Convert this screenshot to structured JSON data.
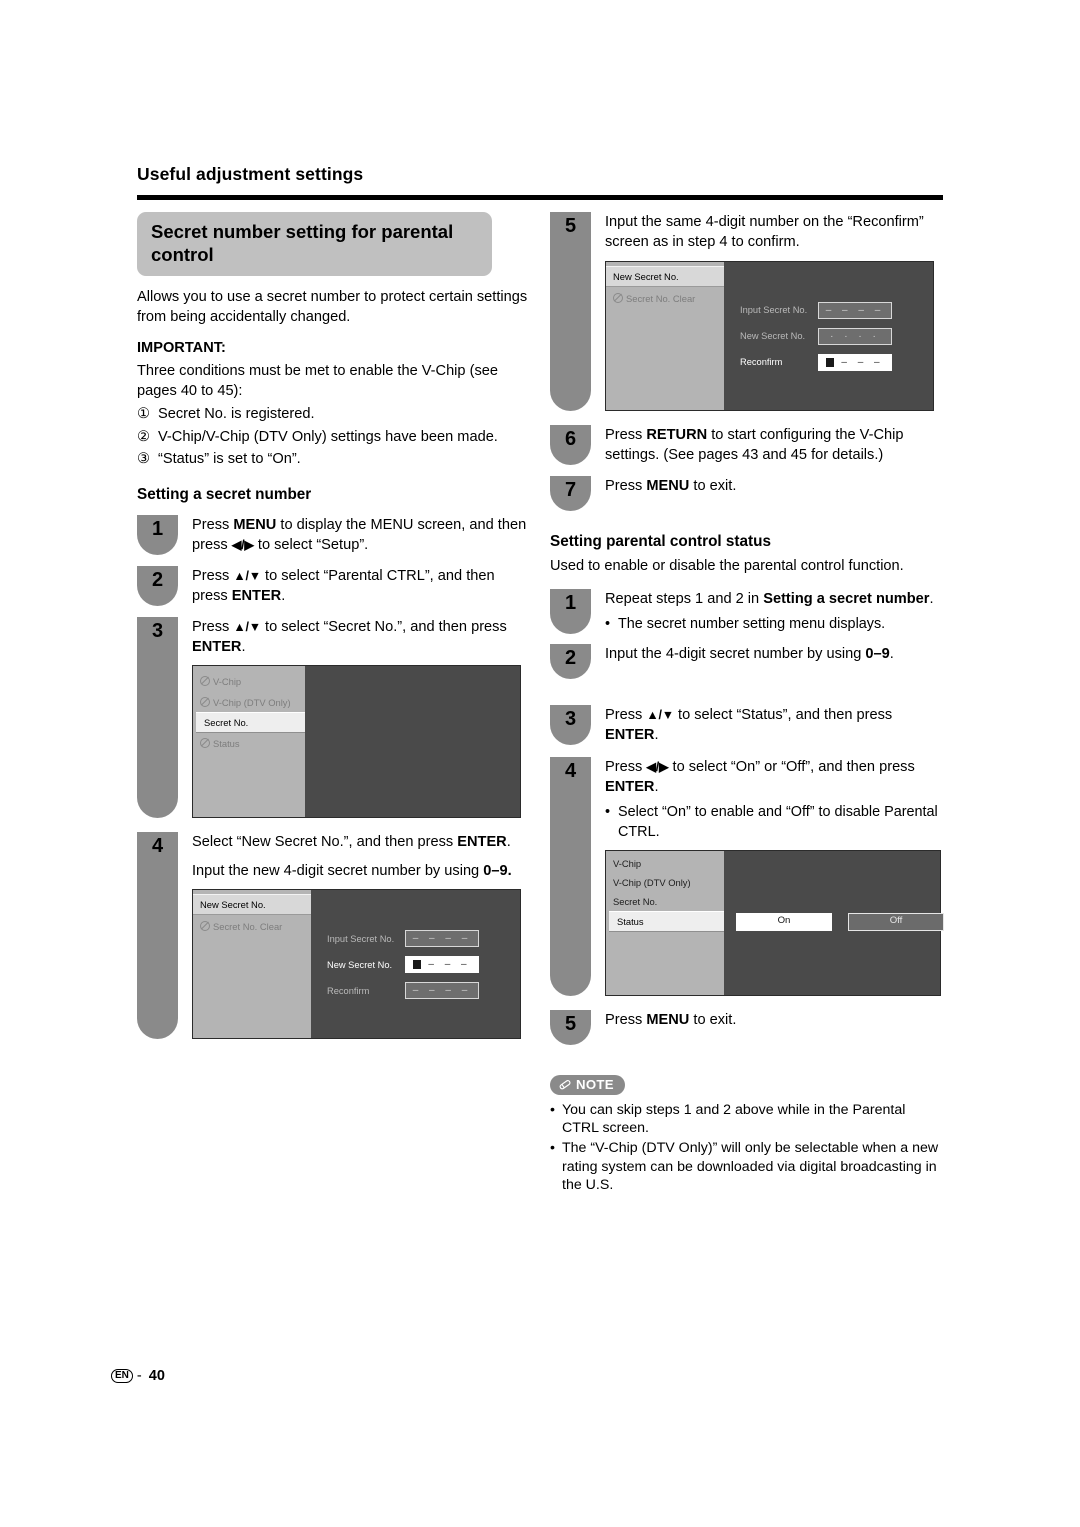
{
  "page": {
    "running_head": "Useful adjustment settings",
    "footer_lang": "EN",
    "footer_dash": "-",
    "footer_page": "40"
  },
  "left": {
    "section_title": "Secret number setting for parental control",
    "intro": "Allows you to use a secret number to protect certain settings from being accidentally changed.",
    "important_label": "IMPORTANT:",
    "important_text": "Three conditions must be met to enable the V-Chip (see pages 40 to 45):",
    "conditions": [
      {
        "num": "①",
        "text": "Secret No. is registered."
      },
      {
        "num": "②",
        "text": "V-Chip/V-Chip (DTV Only) settings have been made."
      },
      {
        "num": "③",
        "text": "“Status” is set to “On”."
      }
    ],
    "subhead": "Setting a secret number",
    "steps": [
      {
        "num": "1",
        "line1_a": "Press ",
        "line1_b": "MENU",
        "line1_c": " to display the MENU screen, and then press ",
        "line1_d": "◀/▶",
        "line1_e": " to select “Setup”."
      },
      {
        "num": "2",
        "line1_a": "Press ",
        "line1_b": "▲/▼",
        "line1_c": " to select “Parental CTRL”, and then press ",
        "line1_d": "ENTER",
        "line1_e": "."
      },
      {
        "num": "3",
        "line1_a": "Press ",
        "line1_b": "▲/▼",
        "line1_c": " to select “Secret No.”, and then press  ",
        "line1_d": "ENTER",
        "line1_e": "."
      },
      {
        "num": "4",
        "line1_a": "Select “New Secret No.”, and then press ",
        "line1_b": "ENTER",
        "line1_c": ".",
        "line2_a": "Input the new 4-digit secret number by using ",
        "line2_b": "0–9."
      }
    ],
    "screen_vchip": {
      "items": [
        {
          "label": "V-Chip",
          "state": "disabled"
        },
        {
          "label": "V-Chip (DTV Only)",
          "state": "disabled"
        },
        {
          "label": "Secret No.",
          "state": "selected"
        },
        {
          "label": "Status",
          "state": "disabled"
        }
      ]
    },
    "screen_newsecret": {
      "items": [
        {
          "label": "New Secret No.",
          "state": "selected-plain"
        },
        {
          "label": "Secret No. Clear",
          "state": "disabled"
        }
      ],
      "fields": [
        {
          "label": "Input Secret No.",
          "value": "– – – –",
          "active": false
        },
        {
          "label": "New Secret No.",
          "value": "– – –",
          "active": true,
          "cursor": true
        },
        {
          "label": "Reconfirm",
          "value": "– – – –",
          "active": false
        }
      ]
    }
  },
  "right": {
    "steps_top": [
      {
        "num": "5",
        "line1_a": "Input the same 4-digit number on the “Reconfirm” screen as in step 4 to confirm.",
        "line1_b": "",
        "line1_c": ""
      },
      {
        "num": "6",
        "line1_a": "Press ",
        "line1_b": "RETURN",
        "line1_c": " to start configuring the V-Chip settings. (See pages 43 and 45 for details.)"
      },
      {
        "num": "7",
        "line1_a": "Press ",
        "line1_b": "MENU",
        "line1_c": " to exit."
      }
    ],
    "screen_reconfirm": {
      "items": [
        {
          "label": "New Secret No.",
          "state": "selected-plain"
        },
        {
          "label": "Secret No. Clear",
          "state": "disabled"
        }
      ],
      "fields": [
        {
          "label": "Input Secret No.",
          "value": "– – – –",
          "active": false
        },
        {
          "label": "New Secret No.",
          "value": "· · · ·",
          "active": false
        },
        {
          "label": "Reconfirm",
          "value": "– – –",
          "active": true,
          "cursor": true
        }
      ]
    },
    "subhead": "Setting parental control status",
    "subhead_text": "Used to enable or disable the parental control function.",
    "steps_bottom": [
      {
        "num": "1",
        "line1_a": "Repeat steps 1 and 2 in ",
        "line1_b": "Setting a secret number",
        "line1_c": ".",
        "bullet": "The secret number setting menu displays."
      },
      {
        "num": "2",
        "line1_a": "Input the 4-digit secret number by using ",
        "line1_b": "0–9",
        "line1_c": "."
      },
      {
        "num": "3",
        "line1_a": "Press ",
        "line1_b": "▲/▼",
        "line1_c": " to select “Status”, and then press ",
        "line1_d": "ENTER",
        "line1_e": "."
      },
      {
        "num": "4",
        "line1_a": "Press ",
        "line1_b": "◀/▶",
        "line1_c": " to select “On” or “Off”, and then press ",
        "line1_d": "ENTER",
        "line1_e": ".",
        "bullet": "Select “On” to enable and “Off” to disable Parental CTRL."
      },
      {
        "num": "5",
        "line1_a": "Press ",
        "line1_b": "MENU",
        "line1_c": " to exit."
      }
    ],
    "screen_status": {
      "items": [
        {
          "label": "V-Chip",
          "state": "enabled"
        },
        {
          "label": "V-Chip (DTV Only)",
          "state": "enabled"
        },
        {
          "label": "Secret No.",
          "state": "enabled"
        },
        {
          "label": "Status",
          "state": "selected"
        }
      ],
      "buttons": [
        {
          "label": "On",
          "active": true
        },
        {
          "label": "Off",
          "active": false
        }
      ]
    },
    "note": {
      "badge": "NOTE",
      "items": [
        "You can skip steps 1 and 2 above while in the Parental CTRL screen.",
        "The “V-Chip (DTV Only)” will only be selectable when a new rating system can be downloaded via digital broadcasting in the U.S."
      ]
    }
  },
  "colors": {
    "badge_gray": "#8a8a8a",
    "pill_gray": "#c0c0c0",
    "screen_dark": "#4a4a4a",
    "screen_side": "#b4b4b4"
  }
}
